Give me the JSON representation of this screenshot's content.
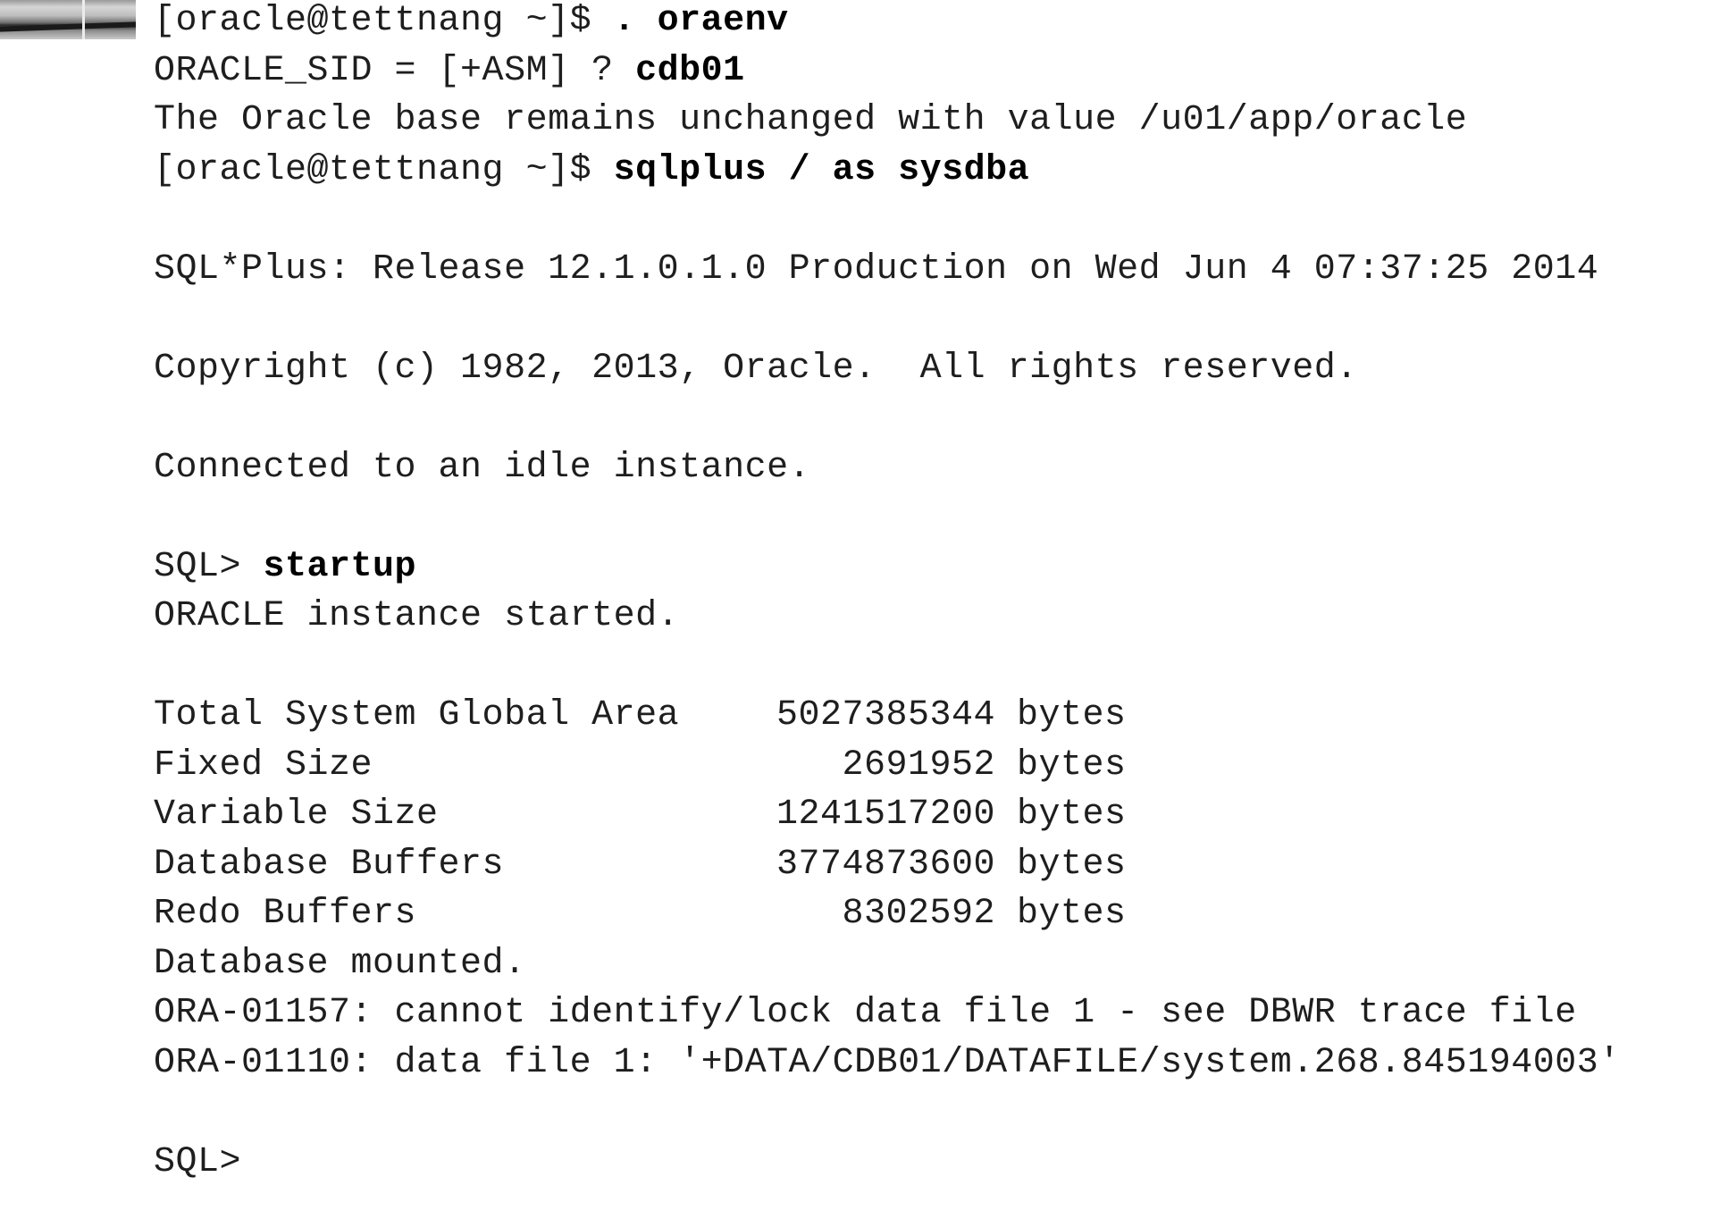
{
  "terminal": {
    "line1_prompt": "[oracle@tettnang ~]$",
    "line1_cmd": ". oraenv",
    "line2_prompt": "ORACLE_SID = [+ASM] ?",
    "line2_answer": "cdb01",
    "line3": "The Oracle base remains unchanged with value /u01/app/oracle",
    "line4_prompt": "[oracle@tettnang ~]$",
    "line4_cmd": "sqlplus / as sysdba",
    "banner": "SQL*Plus: Release 12.1.0.1.0 Production on Wed Jun 4 07:37:25 2014",
    "copyright": "Copyright (c) 1982, 2013, Oracle.  All rights reserved.",
    "connected": "Connected to an idle instance.",
    "sql_prompt": "SQL>",
    "startup_cmd": "startup",
    "instance_started": "ORACLE instance started.",
    "sga": [
      {
        "name": "Total System Global Area",
        "value": "5027385344",
        "unit": "bytes"
      },
      {
        "name": "Fixed Size",
        "value": "2691952",
        "unit": "bytes"
      },
      {
        "name": "Variable Size",
        "value": "1241517200",
        "unit": "bytes"
      },
      {
        "name": "Database Buffers",
        "value": "3774873600",
        "unit": "bytes"
      },
      {
        "name": "Redo Buffers",
        "value": "8302592",
        "unit": "bytes"
      }
    ],
    "mounted": "Database mounted.",
    "error1": "ORA-01157: cannot identify/lock data file 1 - see DBWR trace file",
    "error2": "ORA-01110: data file 1: '+DATA/CDB01/DATAFILE/system.268.845194003'",
    "final_prompt": "SQL>"
  }
}
